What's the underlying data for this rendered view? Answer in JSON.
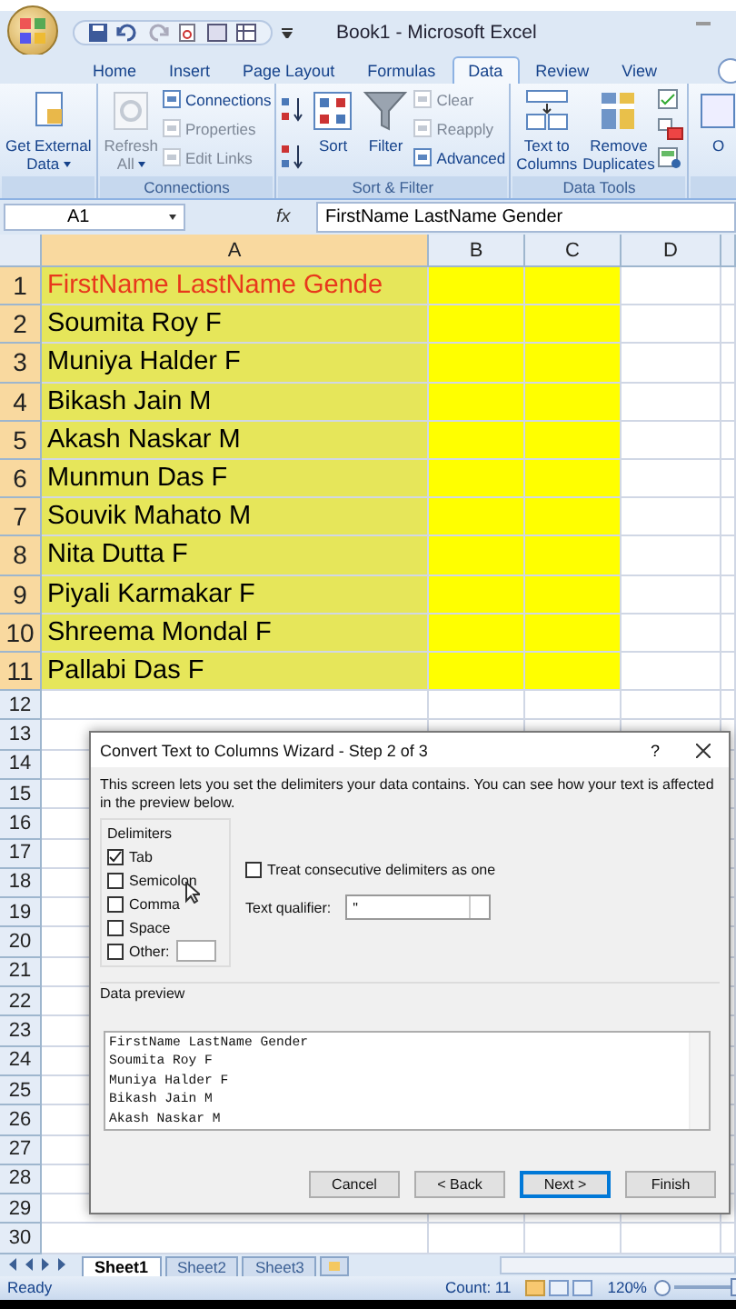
{
  "window": {
    "title": "Book1 - Microsoft Excel"
  },
  "ribbon_tabs": [
    {
      "label": "Home",
      "selected": false
    },
    {
      "label": "Insert",
      "selected": false
    },
    {
      "label": "Page Layout",
      "selected": false
    },
    {
      "label": "Formulas",
      "selected": false
    },
    {
      "label": "Data",
      "selected": true
    },
    {
      "label": "Review",
      "selected": false
    },
    {
      "label": "View",
      "selected": false
    }
  ],
  "ribbon_groups": [
    {
      "items": [
        {
          "kind": "large",
          "label": "Get External\nData",
          "menu": true,
          "disabled": false
        }
      ]
    },
    {
      "label": "Connections",
      "items": [
        {
          "kind": "large",
          "label": "Refresh\nAll",
          "menu": true,
          "disabled": true
        },
        {
          "kind": "small",
          "label": "Connections",
          "disabled": false
        },
        {
          "kind": "small",
          "label": "Properties",
          "disabled": true
        },
        {
          "kind": "small",
          "label": "Edit Links",
          "disabled": true
        }
      ]
    },
    {
      "label": "Sort & Filter",
      "items": [
        {
          "kind": "icon"
        },
        {
          "kind": "icon"
        },
        {
          "kind": "large",
          "label": "Sort",
          "menu": false,
          "disabled": false
        },
        {
          "kind": "large",
          "label": "Filter",
          "menu": false,
          "disabled": false
        },
        {
          "kind": "small",
          "label": "Clear",
          "disabled": true
        },
        {
          "kind": "small",
          "label": "Reapply",
          "disabled": true
        },
        {
          "kind": "small",
          "label": "Advanced",
          "disabled": false
        }
      ]
    },
    {
      "label": "Data Tools",
      "items": [
        {
          "kind": "large",
          "label": "Text to\nColumns",
          "menu": false,
          "disabled": false
        },
        {
          "kind": "large",
          "label": "Remove\nDuplicates",
          "menu": false,
          "disabled": false
        },
        {
          "kind": "icon"
        },
        {
          "kind": "icon"
        },
        {
          "kind": "icon"
        }
      ]
    },
    {
      "items": [
        {
          "kind": "large",
          "label": "O",
          "menu": false,
          "disabled": false
        }
      ]
    }
  ],
  "formula_bar": {
    "name_box": "A1",
    "fx": "fx",
    "formula": "FirstName LastName Gender"
  },
  "columns": [
    {
      "label": "A",
      "selected": true
    },
    {
      "label": "B",
      "selected": false
    },
    {
      "label": "C",
      "selected": false
    },
    {
      "label": "D",
      "selected": false
    }
  ],
  "rows": [
    {
      "number": "1",
      "selected": true,
      "cells": [
        "FirstName LastName Gende",
        "",
        ""
      ]
    },
    {
      "number": "2",
      "selected": true,
      "cells": [
        "Soumita Roy F",
        "",
        ""
      ]
    },
    {
      "number": "3",
      "selected": true,
      "cells": [
        "Muniya Halder F",
        "",
        ""
      ]
    },
    {
      "number": "4",
      "selected": true,
      "cells": [
        "Bikash Jain M",
        "",
        ""
      ]
    },
    {
      "number": "5",
      "selected": true,
      "cells": [
        "Akash Naskar M",
        "",
        ""
      ]
    },
    {
      "number": "6",
      "selected": true,
      "cells": [
        "Munmun Das F",
        "",
        ""
      ]
    },
    {
      "number": "7",
      "selected": true,
      "cells": [
        "Souvik Mahato M",
        "",
        ""
      ]
    },
    {
      "number": "8",
      "selected": true,
      "cells": [
        "Nita Dutta F",
        "",
        ""
      ]
    },
    {
      "number": "9",
      "selected": true,
      "cells": [
        "Piyali Karmakar F",
        "",
        ""
      ]
    },
    {
      "number": "10",
      "selected": true,
      "cells": [
        "Shreema Mondal F",
        "",
        ""
      ]
    },
    {
      "number": "11",
      "selected": true,
      "cells": [
        "Pallabi Das F",
        "",
        ""
      ]
    },
    {
      "number": "12",
      "selected": false
    },
    {
      "number": "13",
      "selected": false
    },
    {
      "number": "14",
      "selected": false
    },
    {
      "number": "15",
      "selected": false
    },
    {
      "number": "16",
      "selected": false
    },
    {
      "number": "17",
      "selected": false
    },
    {
      "number": "18",
      "selected": false
    },
    {
      "number": "19",
      "selected": false
    },
    {
      "number": "20",
      "selected": false
    },
    {
      "number": "21",
      "selected": false
    },
    {
      "number": "22",
      "selected": false
    },
    {
      "number": "23",
      "selected": false
    },
    {
      "number": "24",
      "selected": false
    },
    {
      "number": "25",
      "selected": false
    },
    {
      "number": "26",
      "selected": false
    },
    {
      "number": "27",
      "selected": false
    },
    {
      "number": "28",
      "selected": false
    },
    {
      "number": "29",
      "selected": false
    },
    {
      "number": "30",
      "selected": false
    }
  ],
  "dialog": {
    "title": "Convert Text to Columns Wizard - Step 2 of 3",
    "help": "?",
    "description": "This screen lets you set the delimiters your data contains.  You can see how your text is affected in the preview below.",
    "delimiters_label": "Delimiters",
    "delimiters": [
      {
        "label": "Tab",
        "checked": true
      },
      {
        "label": "Semicolon",
        "checked": false
      },
      {
        "label": "Comma",
        "checked": false
      },
      {
        "label": "Space",
        "checked": false
      },
      {
        "label": "Other:",
        "checked": false
      }
    ],
    "treat_consecutive": {
      "label": "Treat consecutive delimiters as one",
      "checked": false
    },
    "text_qualifier": {
      "label": "Text qualifier:",
      "value": "\""
    },
    "preview_label": "Data preview",
    "preview_lines": [
      "FirstName LastName Gender",
      "Soumita Roy F",
      "Muniya Halder F",
      "Bikash Jain M",
      "Akash Naskar M"
    ],
    "buttons": [
      {
        "label": "Cancel",
        "default": false
      },
      {
        "label": "< Back",
        "default": false
      },
      {
        "label": "Next >",
        "default": true
      },
      {
        "label": "Finish",
        "default": false
      }
    ]
  },
  "sheet_tabs": [
    {
      "label": "Sheet1",
      "selected": true
    },
    {
      "label": "Sheet2",
      "selected": false
    },
    {
      "label": "Sheet3",
      "selected": false
    }
  ],
  "status_bar": {
    "status": "Ready",
    "count": "Count: 11",
    "views": [
      {
        "selected": true
      },
      {
        "selected": false
      },
      {
        "selected": false
      }
    ],
    "zoom": "120%",
    "zoom_slider": {
      "level": 0.97
    }
  }
}
